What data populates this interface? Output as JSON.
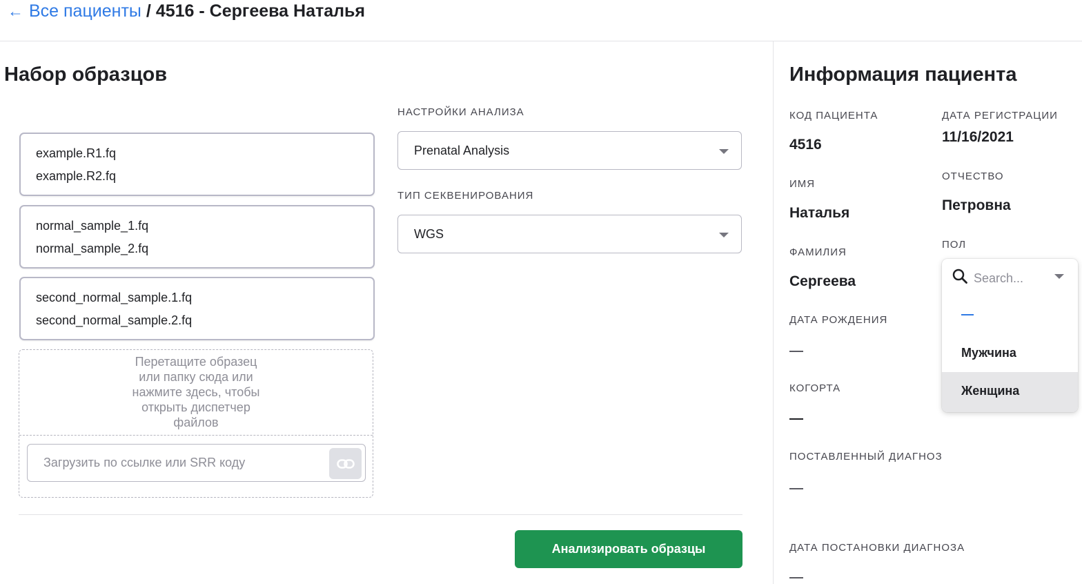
{
  "breadcrumb": {
    "back_arrow": "←",
    "back_label": "Все пациенты",
    "separator": "/",
    "current": "4516 - Сергеева Наталья"
  },
  "samples_panel": {
    "title": "Набор образцов",
    "samples": [
      {
        "file1": "example.R1.fq",
        "file2": "example.R2.fq"
      },
      {
        "file1": "normal_sample_1.fq",
        "file2": "normal_sample_2.fq"
      },
      {
        "file1": "second_normal_sample.1.fq",
        "file2": "second_normal_sample.2.fq"
      }
    ],
    "dropzone": {
      "line1": "Перетащите образец",
      "line2": "или папку сюда или",
      "line3": "нажмите здесь, чтобы",
      "line4": "открыть диспетчер",
      "line5": "файлов",
      "url_placeholder": "Загрузить по ссылке или SRR коду",
      "link_icon": "link-icon"
    }
  },
  "analysis": {
    "settings_label": "НАСТРОЙКИ АНАЛИЗА",
    "settings_value": "Prenatal Analysis",
    "seq_type_label": "ТИП СЕКВЕНИРОВАНИЯ",
    "seq_type_value": "WGS",
    "analyze_button": "Анализировать образцы"
  },
  "patient_info": {
    "title": "Информация пациента",
    "code_label": "КОД ПАЦИЕНТА",
    "code_value": "4516",
    "reg_date_label": "ДАТА РЕГИСТРАЦИИ",
    "reg_date_value": "11/16/2021",
    "first_name_label": "ИМЯ",
    "first_name_value": "Наталья",
    "patronymic_label": "ОТЧЕСТВО",
    "patronymic_value": "Петровна",
    "last_name_label": "ФАМИЛИЯ",
    "last_name_value": "Сергеева",
    "gender_label": "ПОЛ",
    "birth_date_label": "ДАТА РОЖДЕНИЯ",
    "cohort_label": "КОГОРТА",
    "diagnosis_label": "ПОСТАВЛЕННЫЙ ДИАГНОЗ",
    "diagnosis_date_label": "ДАТА ПОСТАНОВКИ ДИАГНОЗА"
  },
  "gender_dropdown": {
    "search_placeholder": "Search...",
    "options": [
      "Мужчина",
      "Женщина"
    ],
    "selected": "Женщина"
  },
  "colors": {
    "link_blue": "#2f7ae5",
    "primary_green": "#1e9451",
    "border_gray": "#b8b8c7"
  }
}
